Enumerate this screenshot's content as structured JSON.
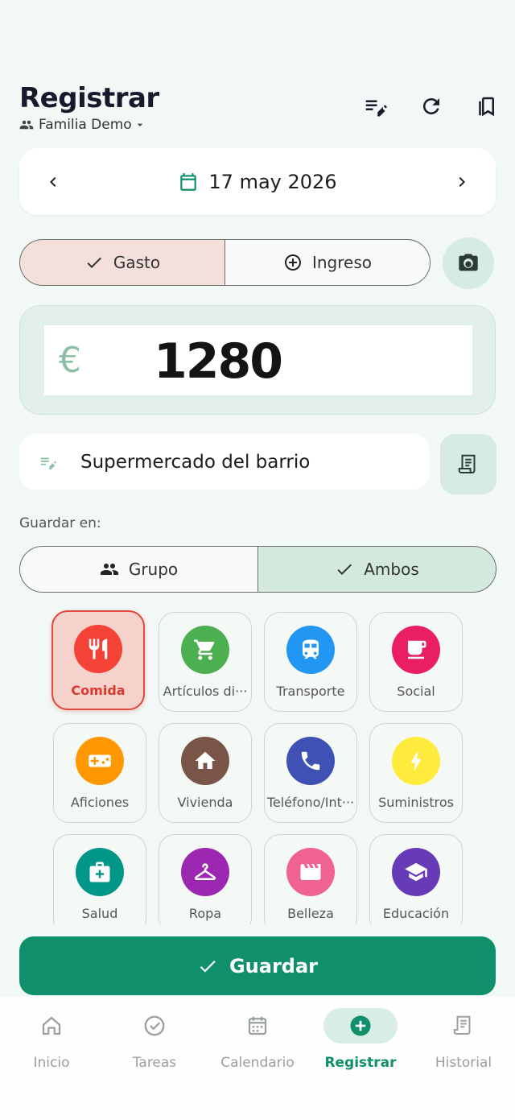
{
  "header": {
    "title": "Registrar",
    "family_selector": "Familia Demo"
  },
  "date": {
    "value": "17 may 2026"
  },
  "type_toggle": {
    "expense_label": "Gasto",
    "income_label": "Ingreso",
    "selected": "Gasto"
  },
  "amount": {
    "currency_symbol": "€",
    "value": "1280"
  },
  "description": {
    "value": "Supermercado del barrio"
  },
  "save_in": {
    "label": "Guardar en:",
    "group_label": "Grupo",
    "both_label": "Ambos",
    "selected": "Ambos"
  },
  "categories": [
    {
      "label": "Comida",
      "color": "#f44336",
      "icon": "restaurant-icon",
      "selected": true
    },
    {
      "label": "Artículos di···",
      "color": "#4caf50",
      "icon": "cart-icon"
    },
    {
      "label": "Transporte",
      "color": "#2196f3",
      "icon": "train-icon"
    },
    {
      "label": "Social",
      "color": "#e91e63",
      "icon": "cup-icon"
    },
    {
      "label": "Aficiones",
      "color": "#ff9800",
      "icon": "gamepad-icon"
    },
    {
      "label": "Vivienda",
      "color": "#795548",
      "icon": "home-icon"
    },
    {
      "label": "Teléfono/Int···",
      "color": "#3f51b5",
      "icon": "phone-icon"
    },
    {
      "label": "Suministros",
      "color": "#ffeb3b",
      "icon": "bolt-icon"
    },
    {
      "label": "Salud",
      "color": "#009688",
      "icon": "medkit-icon"
    },
    {
      "label": "Ropa",
      "color": "#9c27b0",
      "icon": "hanger-icon"
    },
    {
      "label": "Belleza",
      "color": "#f06292",
      "icon": "clapper-icon"
    },
    {
      "label": "Educación",
      "color": "#673ab7",
      "icon": "school-icon"
    }
  ],
  "save_button": {
    "label": "Guardar"
  },
  "nav": {
    "items": [
      {
        "label": "Inicio",
        "icon": "home-outline-icon"
      },
      {
        "label": "Tareas",
        "icon": "check-circle-icon"
      },
      {
        "label": "Calendario",
        "icon": "calendar-icon"
      },
      {
        "label": "Registrar",
        "icon": "add-circle-icon",
        "active": true
      },
      {
        "label": "Historial",
        "icon": "receipt-icon"
      }
    ]
  },
  "colors": {
    "accent": "#108f6b",
    "background": "#f2f8f5",
    "expense_selected": "#f3dfdb",
    "selected_category_border": "#e2483b"
  }
}
